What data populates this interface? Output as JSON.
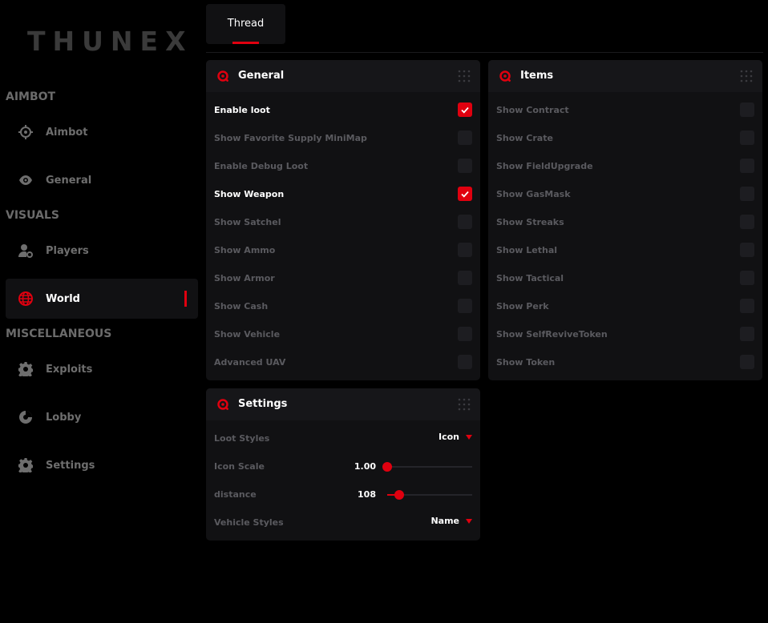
{
  "app": {
    "logo": "THUNEX"
  },
  "sidebar": {
    "sections": [
      "AIMBOT",
      "VISUALS",
      "MISCELLANEOUS"
    ],
    "items": [
      {
        "label": "Aimbot",
        "icon": "crosshair-icon"
      },
      {
        "label": "General",
        "icon": "eye-icon"
      },
      {
        "label": "Players",
        "icon": "user-gear-icon"
      },
      {
        "label": "World",
        "icon": "globe-icon",
        "active": true
      },
      {
        "label": "Exploits",
        "icon": "gear-icon"
      },
      {
        "label": "Lobby",
        "icon": "lobby-icon"
      },
      {
        "label": "Settings",
        "icon": "gear-icon"
      }
    ]
  },
  "tabs": [
    {
      "label": "Thread",
      "active": true
    }
  ],
  "general": {
    "title": "General",
    "rows": [
      {
        "label": "Enable loot",
        "checked": true
      },
      {
        "label": "Show Favorite Supply MiniMap",
        "checked": false
      },
      {
        "label": "Enable Debug Loot",
        "checked": false
      },
      {
        "label": "Show Weapon",
        "checked": true
      },
      {
        "label": "Show Satchel",
        "checked": false
      },
      {
        "label": "Show Ammo",
        "checked": false
      },
      {
        "label": "Show Armor",
        "checked": false
      },
      {
        "label": "Show Cash",
        "checked": false
      },
      {
        "label": "Show Vehicle",
        "checked": false
      },
      {
        "label": "Advanced UAV",
        "checked": false
      }
    ]
  },
  "items": {
    "title": "Items",
    "rows": [
      {
        "label": "Show Contract",
        "checked": false
      },
      {
        "label": "Show Crate",
        "checked": false
      },
      {
        "label": "Show FieldUpgrade",
        "checked": false
      },
      {
        "label": "Show GasMask",
        "checked": false
      },
      {
        "label": "Show Streaks",
        "checked": false
      },
      {
        "label": "Show Lethal",
        "checked": false
      },
      {
        "label": "Show Tactical",
        "checked": false
      },
      {
        "label": "Show Perk",
        "checked": false
      },
      {
        "label": "Show SelfReviveToken",
        "checked": false
      },
      {
        "label": "Show Token",
        "checked": false
      }
    ]
  },
  "settings": {
    "title": "Settings",
    "loot_styles": {
      "label": "Loot Styles",
      "value": "Icon"
    },
    "icon_scale": {
      "label": "Icon Scale",
      "value": "1.00",
      "fraction": 0.0
    },
    "distance": {
      "label": "distance",
      "value": "108",
      "fraction": 0.14
    },
    "vehicle_styles": {
      "label": "Vehicle Styles",
      "value": "Name"
    }
  },
  "colors": {
    "accent": "#e0000f",
    "panel": "#111113",
    "header": "#161619",
    "muted": "#5a5a5f"
  }
}
